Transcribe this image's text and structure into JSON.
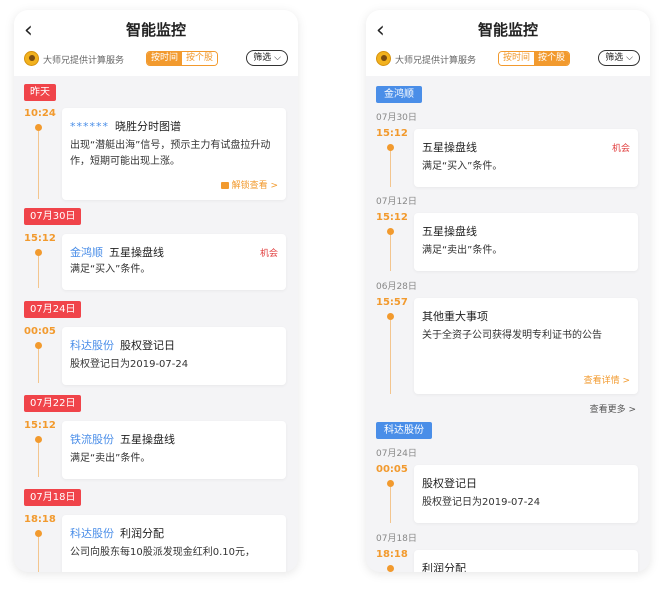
{
  "screens": [
    {
      "header": {
        "title": "智能监控",
        "provider": "大师兄提供计算服务",
        "toggle": [
          "按时间",
          "按个股"
        ],
        "filter_label": "筛选",
        "back_glyph": "‹"
      },
      "badges": {
        "yesterday": "昨天",
        "d0730": "07月30日",
        "d0724": "07月24日",
        "d0722": "07月22日",
        "d0718": "07月18日"
      },
      "items": [
        {
          "time": "10:24",
          "masked": "******",
          "strategy": "晓胜分时图谱",
          "body": "出现“潜艇出海”信号，预示主力有试盘拉升动作，短期可能出现上涨。",
          "link": "解锁查看 >"
        },
        {
          "time": "15:12",
          "stock": "金鸿顺",
          "strategy": "五星操盘线",
          "tag": "机会",
          "body": "满足“买入”条件。"
        },
        {
          "time": "00:05",
          "stock": "科达股份",
          "strategy": "股权登记日",
          "body": "股权登记日为2019-07-24"
        },
        {
          "time": "15:12",
          "stock": "铁流股份",
          "strategy": "五星操盘线",
          "body": "满足“卖出”条件。"
        },
        {
          "time": "18:18",
          "stock": "科达股份",
          "strategy": "利润分配",
          "body": "公司向股东每10股派发现金红利0.10元，"
        }
      ]
    },
    {
      "header": {
        "title": "智能监控",
        "provider": "大师兄提供计算服务",
        "toggle": [
          "按时间",
          "按个股"
        ],
        "filter_label": "筛选",
        "back_glyph": "‹"
      },
      "groups": {
        "g1": "金鸿顺",
        "g2": "科达股份"
      },
      "dates": {
        "d0730": "07月30日",
        "d0712": "07月12日",
        "d0628": "06月28日",
        "d0724": "07月24日",
        "d0718": "07月18日"
      },
      "items": [
        {
          "time": "15:12",
          "strategy": "五星操盘线",
          "tag": "机会",
          "body": "满足“买入”条件。"
        },
        {
          "time": "15:12",
          "strategy": "五星操盘线",
          "body": "满足“卖出”条件。"
        },
        {
          "time": "15:57",
          "strategy": "其他重大事项",
          "body": "关于全资子公司获得发明专利证书的公告",
          "link": "查看详情 >"
        },
        {
          "time": "00:05",
          "strategy": "股权登记日",
          "body": "股权登记日为2019-07-24"
        },
        {
          "time": "18:18",
          "strategy": "利润分配"
        }
      ],
      "more_label": "查看更多 >"
    }
  ],
  "colors": {
    "accent": "#f29a2e",
    "date_badge": "#f0444a",
    "group_badge": "#4a8ee8",
    "stock_link": "#4a8ee8",
    "opportunity": "#e03b3b"
  }
}
